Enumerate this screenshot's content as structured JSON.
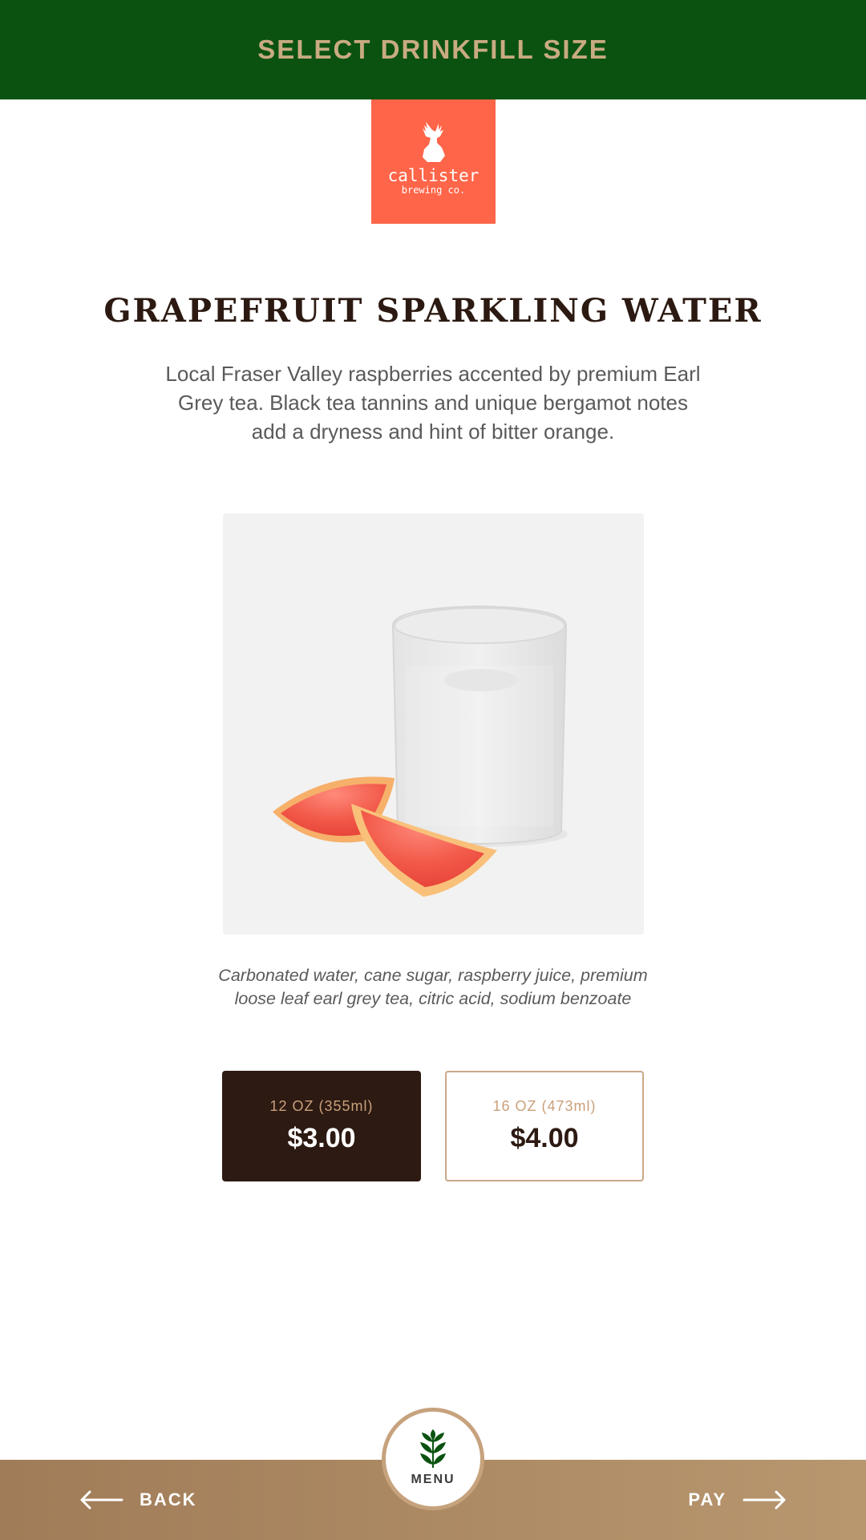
{
  "header": {
    "title": "SELECT DRINKFILL SIZE"
  },
  "logo": {
    "name": "callister",
    "sub": "brewing co."
  },
  "product": {
    "title": "GRAPEFRUIT SPARKLING WATER",
    "description": "Local Fraser Valley raspberries accented by premium Earl Grey tea. Black tea tannins and unique bergamot notes add a dryness and hint of bitter orange.",
    "ingredients": "Carbonated water, cane sugar, raspberry juice, premium loose leaf earl grey tea, citric acid, sodium benzoate"
  },
  "sizes": [
    {
      "label": "12 OZ (355ml)",
      "price": "$3.00",
      "selected": true
    },
    {
      "label": "16 OZ (473ml)",
      "price": "$4.00",
      "selected": false
    }
  ],
  "footer": {
    "back_label": "BACK",
    "pay_label": "PAY",
    "menu_label": "MENU"
  },
  "colors": {
    "header_bg": "#0b5211",
    "accent_gold": "#c9ab82",
    "logo_bg": "#ff6549",
    "dark_brown": "#2d1a12",
    "footer_tan": "#a07c58"
  },
  "icons": [
    "deer-logo-icon",
    "back-arrow-icon",
    "pay-arrow-icon",
    "wheat-leaf-icon"
  ]
}
